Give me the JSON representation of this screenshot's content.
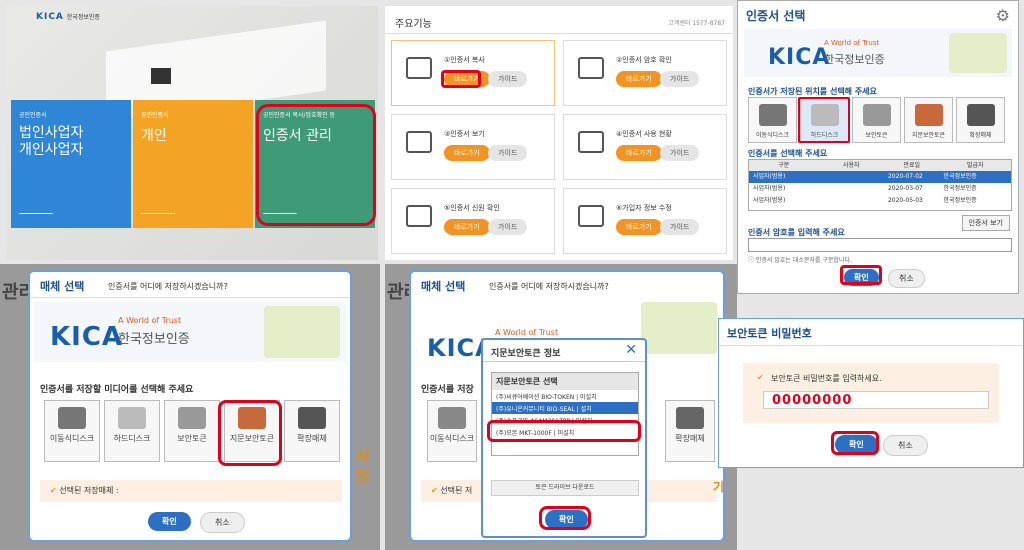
{
  "p1": {
    "logo": "KICA",
    "logo_sub": "한국정보인증",
    "cards": [
      {
        "small": "공인인증서",
        "title": "법인사업자\n개인사업자"
      },
      {
        "small": "공인인증서",
        "title": "개인"
      },
      {
        "small": "공인인증서 복사/암호확인 등",
        "title": "인증서 관리"
      }
    ]
  },
  "p2": {
    "title": "주요기능",
    "phone": "고객센터 1577-8787",
    "items": [
      {
        "num": "①",
        "name": "인증서 복사",
        "go": "바로가기",
        "guide": "가이드"
      },
      {
        "num": "②",
        "name": "인증서 암호 확인",
        "go": "바로가기",
        "guide": "가이드"
      },
      {
        "num": "③",
        "name": "인증서 보기",
        "go": "바로가기",
        "guide": "가이드"
      },
      {
        "num": "④",
        "name": "인증서 사용 현황",
        "go": "바로가기",
        "guide": "가이드"
      },
      {
        "num": "⑤",
        "name": "인증서 신원 확인",
        "go": "바로가기",
        "guide": "가이드"
      },
      {
        "num": "⑥",
        "name": "가입자 정보 수정",
        "go": "바로가기",
        "guide": "가이드"
      }
    ]
  },
  "p3": {
    "title": "인증서 선택",
    "slogan": "A World of Trust",
    "kica": "KICA",
    "kica_kr": "한국정보인증",
    "loc_label": "인증서가 저장된 위치를 선택해 주세요",
    "media": [
      "이동식디스크",
      "하드디스크",
      "보안토큰",
      "지문보안토큰",
      "확장매체"
    ],
    "cert_label": "인증서를 선택해 주세요",
    "cols": [
      "구분",
      "사용자",
      "만료일",
      "발급자"
    ],
    "rows": [
      [
        "사업자(범용)",
        "",
        "2020-07-02",
        "한국정보인증"
      ],
      [
        "사업자(범용)",
        "",
        "2020-03-07",
        "한국정보인증"
      ],
      [
        "사업자(범용)",
        "",
        "2020-05-03",
        "한국정보인증"
      ]
    ],
    "view_btn": "인증서 보기",
    "pw_label": "인증서 암호를 입력해 주세요",
    "pw_note": "인증서 암호는 대소문자를 구분합니다.",
    "ok": "확인",
    "cancel": "취소"
  },
  "p4": {
    "bg_text": "관리",
    "title": "매체 선택",
    "question": "인증서를 어디에 저장하시겠습니까?",
    "slogan": "A World of Trust",
    "kica": "KICA",
    "kica_kr": "한국정보인증",
    "media_label": "인증서를 저장할 미디어를 선택해 주세요",
    "media": [
      "이동식디스크",
      "하드디스크",
      "보안토큰",
      "지문보안토큰",
      "확장매체"
    ],
    "selected": "선택된 저장매체 :",
    "ok": "확인",
    "cancel": "취소",
    "side": "서 암",
    "side2": "기"
  },
  "p5": {
    "bg_text": "관리",
    "title": "매체 선택",
    "question": "인증서를 어디에 저장하시겠습니까?",
    "slogan": "A World of Trust",
    "kica": "KICA",
    "media_label": "인증서를 저장",
    "media": [
      "이동식디스크",
      "확장매체"
    ],
    "selected": "선택된 저",
    "side": "기",
    "popup_title": "지문보안토큰 정보",
    "list_header": "지문보안토큰 선택",
    "list": [
      "(주)씨큐어베이션 BIO-TOKEN | 미설치",
      "(주)유니온커뮤니티 BIO-SEAL | 설치",
      "(주)슈프리마 ASAM2017PP | 미설치",
      "(주)모본 MKT-1000F | 미설치"
    ],
    "download": "토큰 드라이브 다운로드",
    "ok": "확인"
  },
  "p6": {
    "title": "보안토큰 비밀번호",
    "prompt": "보안토큰 비밀번호를 입력하세요.",
    "value": "00000000",
    "ok": "확인",
    "cancel": "취소"
  },
  "colors": {
    "accent": "#f39322",
    "blue": "#2d6fc2",
    "red": "#e0001b",
    "header": "#2a5faa"
  }
}
